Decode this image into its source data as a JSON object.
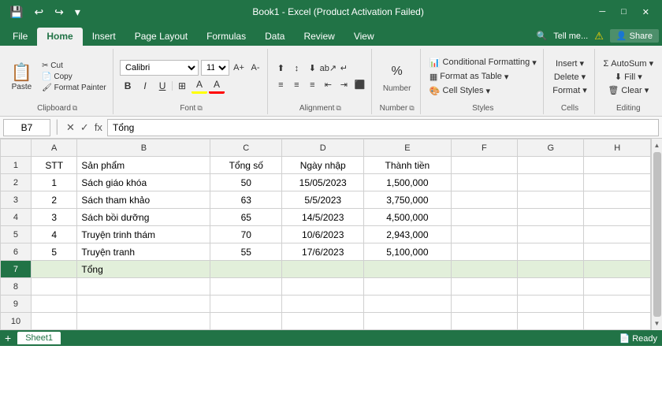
{
  "titleBar": {
    "title": "Book1 - Excel (Product Activation Failed)",
    "saveIcon": "💾",
    "undoIcon": "↩",
    "redoIcon": "↪",
    "dropIcon": "▾"
  },
  "tabs": [
    {
      "label": "File",
      "active": false
    },
    {
      "label": "Home",
      "active": true
    },
    {
      "label": "Insert",
      "active": false
    },
    {
      "label": "Page Layout",
      "active": false
    },
    {
      "label": "Formulas",
      "active": false
    },
    {
      "label": "Data",
      "active": false
    },
    {
      "label": "Review",
      "active": false
    },
    {
      "label": "View",
      "active": false
    }
  ],
  "ribbon": {
    "groups": [
      {
        "name": "Clipboard",
        "items": [
          "Paste",
          "Cut",
          "Copy",
          "Format Painter"
        ]
      },
      {
        "name": "Font",
        "fontName": "Calibri",
        "fontSize": "11",
        "bold": "B",
        "italic": "I",
        "underline": "U"
      },
      {
        "name": "Alignment"
      },
      {
        "name": "Number",
        "symbol": "%"
      },
      {
        "name": "Styles",
        "items": [
          "Conditional Formatting",
          "Format as Table",
          "Cell Styles"
        ]
      },
      {
        "name": "Cells"
      },
      {
        "name": "Editing"
      }
    ]
  },
  "formulaBar": {
    "cellRef": "B7",
    "formula": "Tổng"
  },
  "tellMe": "Tell me...",
  "share": "Share",
  "columnHeaders": [
    "A",
    "B",
    "C",
    "D",
    "E",
    "F",
    "G",
    "H"
  ],
  "rows": [
    {
      "rowNum": "1",
      "cells": [
        "STT",
        "Sản phẩm",
        "Tổng số",
        "Ngày nhập",
        "Thành tiền",
        "",
        "",
        ""
      ]
    },
    {
      "rowNum": "2",
      "cells": [
        "1",
        "Sách giáo khóa",
        "50",
        "15/05/2023",
        "1,500,000",
        "",
        "",
        ""
      ]
    },
    {
      "rowNum": "3",
      "cells": [
        "2",
        "Sách tham khảo",
        "63",
        "5/5/2023",
        "3,750,000",
        "",
        "",
        ""
      ]
    },
    {
      "rowNum": "4",
      "cells": [
        "3",
        "Sách bồi dưỡng",
        "65",
        "14/5/2023",
        "4,500,000",
        "",
        "",
        ""
      ]
    },
    {
      "rowNum": "5",
      "cells": [
        "4",
        "Truyện trinh thám",
        "70",
        "10/6/2023",
        "2,943,000",
        "",
        "",
        ""
      ]
    },
    {
      "rowNum": "6",
      "cells": [
        "5",
        "Truyện tranh",
        "55",
        "17/6/2023",
        "5,100,000",
        "",
        "",
        ""
      ]
    },
    {
      "rowNum": "7",
      "cells": [
        "",
        "Tổng",
        "",
        "",
        "",
        "",
        "",
        ""
      ],
      "selected": true
    },
    {
      "rowNum": "8",
      "cells": [
        "",
        "",
        "",
        "",
        "",
        "",
        "",
        ""
      ]
    },
    {
      "rowNum": "9",
      "cells": [
        "",
        "",
        "",
        "",
        "",
        "",
        "",
        ""
      ]
    },
    {
      "rowNum": "10",
      "cells": [
        "",
        "",
        "",
        "",
        "",
        "",
        "",
        ""
      ]
    }
  ],
  "bottomBar": {
    "sheetName": "Sheet1"
  }
}
